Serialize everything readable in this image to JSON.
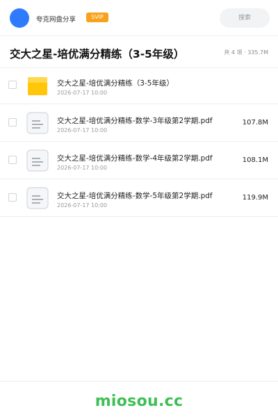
{
  "header": {
    "username": "夸克网盘分享",
    "badge": "SVIP",
    "search_label": "搜索"
  },
  "page": {
    "title": "交大之星-培优满分精练（3-5年级）",
    "meta": "共 4 项 · 335.7M"
  },
  "files": [
    {
      "type": "folder-icon",
      "name": "交大之星-培优满分精练（3-5年级）",
      "date": "2026-07-17 10:00",
      "size": ""
    },
    {
      "type": "document-icon",
      "name": "交大之星-培优满分精练-数学-3年级第2学期.pdf",
      "date": "2026-07-17 10:00",
      "size": "107.8M"
    },
    {
      "type": "document-icon",
      "name": "交大之星-培优满分精练-数学-4年级第2学期.pdf",
      "date": "2026-07-17 10:00",
      "size": "108.1M"
    },
    {
      "type": "document-icon",
      "name": "交大之星-培优满分精练-数学-5年级第2学期.pdf",
      "date": "2026-07-17 10:00",
      "size": "119.9M"
    }
  ],
  "footer": {
    "watermark": "miosou.cc"
  },
  "colors": {
    "accent": "#2f7bff",
    "svip": "#f7a21b",
    "folder": "#ffc60a",
    "watermark": "#3fbf55"
  }
}
